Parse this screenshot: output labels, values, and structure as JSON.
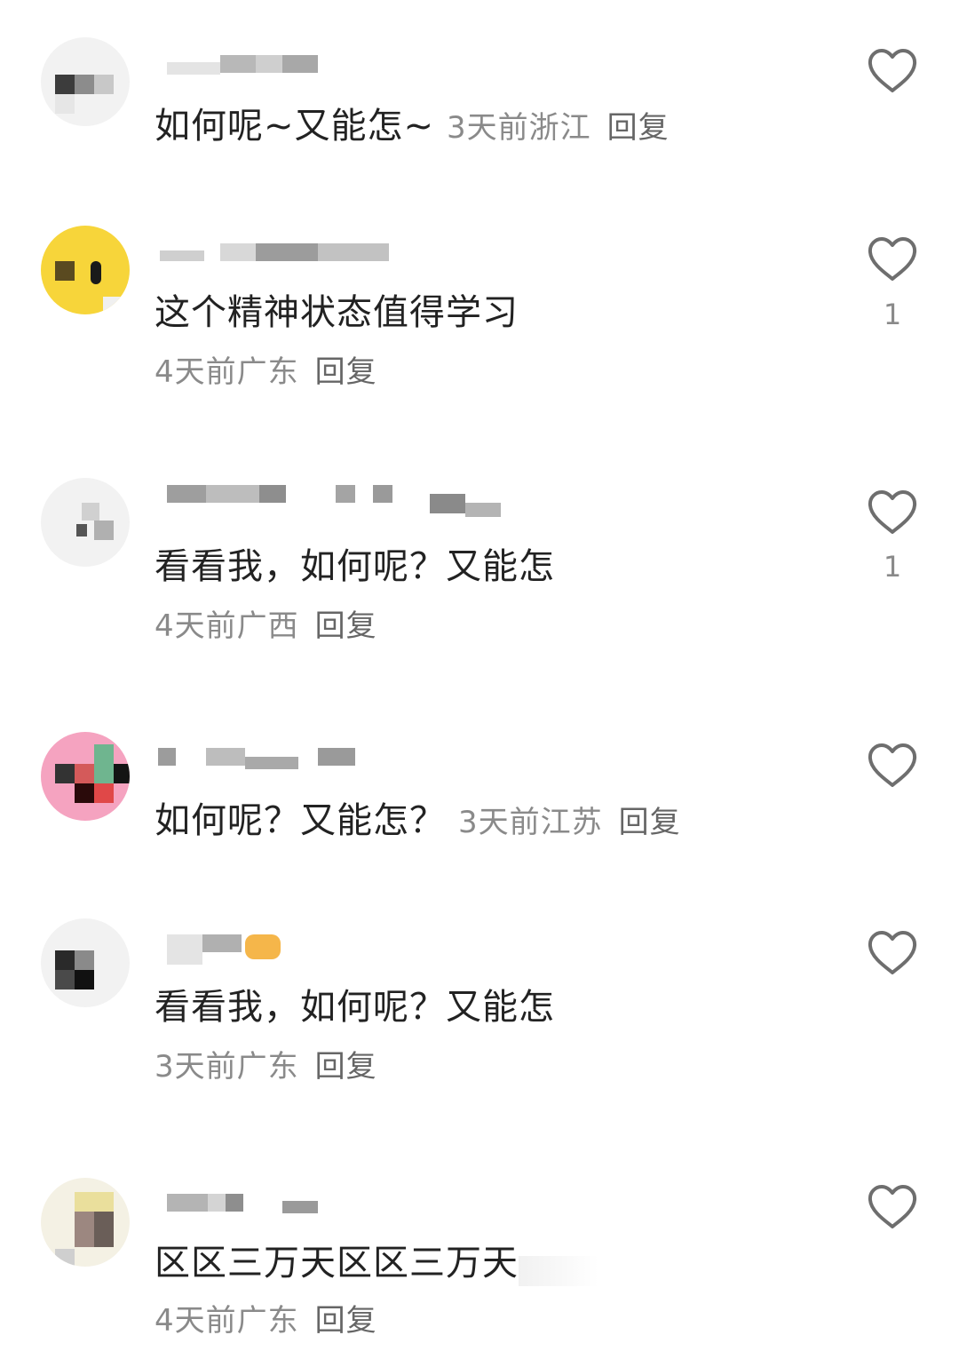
{
  "comments": [
    {
      "text": "如何呢~又能怎~",
      "time": "3天前",
      "location": "浙江",
      "reply_label": "回复",
      "likes": ""
    },
    {
      "text": "这个精神状态值得学习",
      "time": "4天前",
      "location": "广东",
      "reply_label": "回复",
      "likes": "1"
    },
    {
      "text": "看看我，如何呢？又能怎",
      "time": "4天前",
      "location": "广西",
      "reply_label": "回复",
      "likes": "1"
    },
    {
      "text": "如何呢？又能怎？",
      "time": "3天前",
      "location": "江苏",
      "reply_label": "回复",
      "likes": ""
    },
    {
      "text": "看看我，如何呢？又能怎",
      "time": "3天前",
      "location": "广东",
      "reply_label": "回复",
      "likes": ""
    },
    {
      "text": "区区三万天区区三万天",
      "time": "4天前",
      "location": "广东",
      "reply_label": "回复",
      "likes": ""
    }
  ],
  "icons": {
    "like": "heart-outline-icon"
  },
  "colors": {
    "body_text": "#222222",
    "meta_text": "#8a8a8a",
    "reply_text": "#666666",
    "heart_stroke": "#6e6e6e"
  }
}
